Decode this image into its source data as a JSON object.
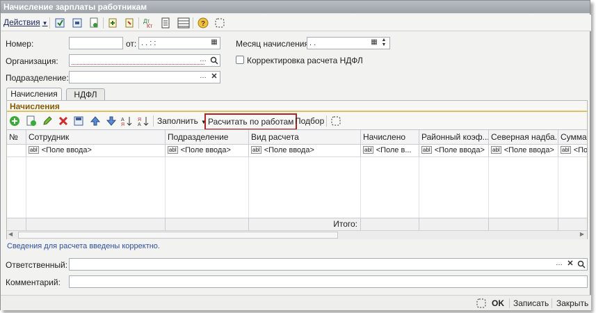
{
  "window": {
    "title": "Начисление зарплаты работникам"
  },
  "toolbar": {
    "actions_label": "Действия"
  },
  "form": {
    "number_label": "Номер:",
    "number_value": "",
    "from_label": "от:",
    "from_value": " .  .       :  :",
    "month_label": "Месяц начисления:",
    "month_value": " .  .",
    "org_label": "Организация:",
    "org_value": "",
    "ndfl_check_label": "Корректировка расчета НДФЛ",
    "ndfl_checked": false,
    "division_label": "Подразделение:",
    "division_value": ""
  },
  "tabs": [
    {
      "label": "Начисления",
      "active": true
    },
    {
      "label": "НДФЛ",
      "active": false
    }
  ],
  "section": {
    "title": "Начисления"
  },
  "grid_toolbar": {
    "fill_label": "Заполнить",
    "calc_label": "Расчитать по работам",
    "select_label": "Подбор"
  },
  "grid": {
    "columns": [
      "№",
      "Сотрудник",
      "Подразделение",
      "Вид расчета",
      "Начислено",
      "Районный коэф...",
      "Северная надба...",
      "Сумма"
    ],
    "row": [
      "",
      "<Поле ввода>",
      "<Поле ввода>",
      "<Поле ввода>",
      "<Поле в...",
      "<Поле ввода>",
      "<Поле ввода>",
      "<По"
    ],
    "abl": "abl",
    "total_label": "Итого:"
  },
  "status": {
    "message": "Сведения для расчета введены корректно."
  },
  "responsible": {
    "label": "Ответственный:",
    "value": ""
  },
  "comment": {
    "label": "Комментарий:",
    "value": ""
  },
  "footer": {
    "ok_label": "OK",
    "save_label": "Записать",
    "close_label": "Закрыть"
  },
  "colors": {
    "title_bar": "#a8acb2",
    "section_title": "#8a5c00",
    "highlight_border": "#b22222",
    "status_text": "#2d4fa3"
  }
}
